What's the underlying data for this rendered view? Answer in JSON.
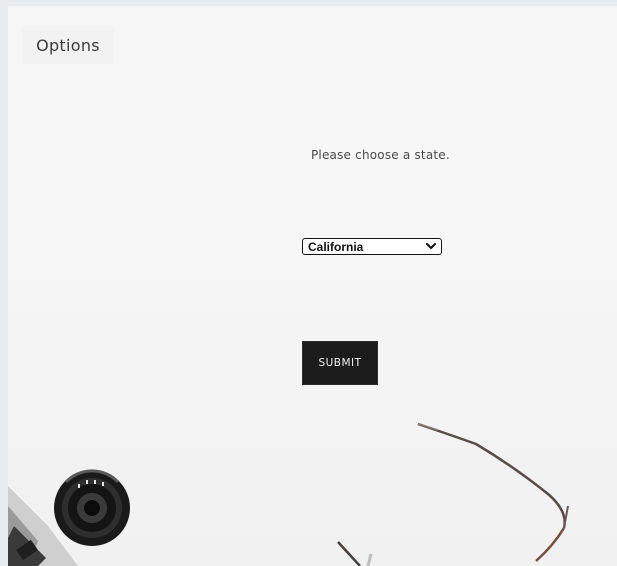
{
  "header": {
    "options_label": "Options"
  },
  "form": {
    "prompt": "Please choose a state.",
    "state_select": {
      "selected": "California"
    },
    "submit_label": "SUBMIT"
  },
  "icons": {
    "dropdown": "chevron-down-icon"
  },
  "colors": {
    "background": "#f6f6f6",
    "button_bg": "#1c1c1c",
    "button_text": "#f2f2f2"
  }
}
